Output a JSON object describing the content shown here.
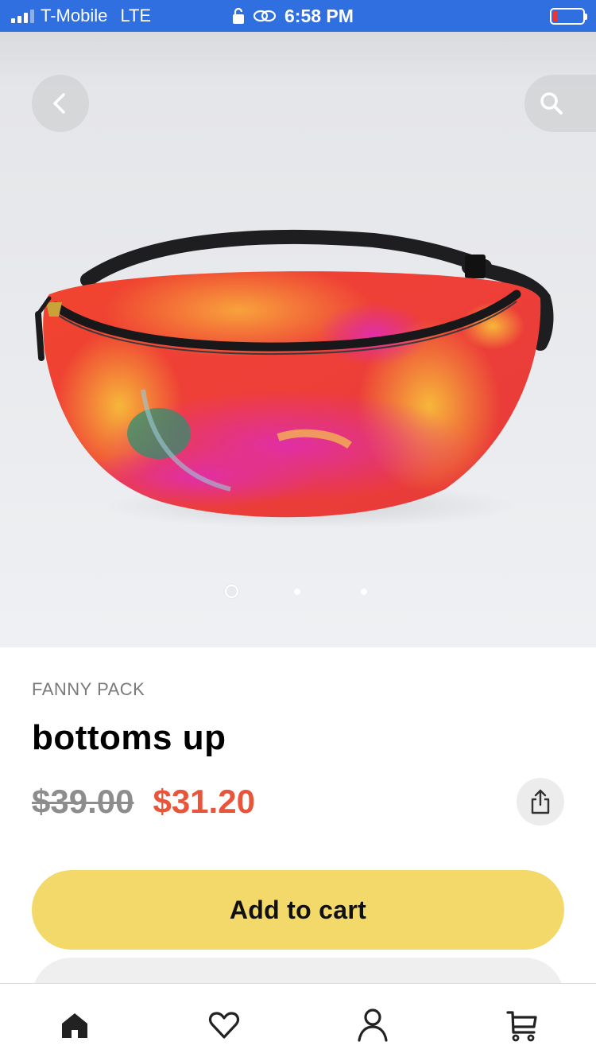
{
  "status_bar": {
    "carrier": "T-Mobile",
    "network": "LTE",
    "time": "6:58 PM",
    "battery_level": "low",
    "icons": [
      "signal-icon",
      "lock-icon",
      "link-icon",
      "battery-icon"
    ]
  },
  "hero": {
    "carousel": {
      "total_slides": 3,
      "active_index": 0
    },
    "back_icon": "chevron-left-icon",
    "search_icon": "search-icon"
  },
  "product": {
    "category": "FANNY PACK",
    "title": "bottoms up",
    "original_price": "$39.00",
    "sale_price": "$31.20",
    "share_icon": "share-icon"
  },
  "actions": {
    "add_to_cart_label": "Add to cart"
  },
  "bottom_nav": {
    "items": [
      {
        "name": "home",
        "icon": "home-icon",
        "active": true
      },
      {
        "name": "wishlist",
        "icon": "heart-icon",
        "active": false
      },
      {
        "name": "account",
        "icon": "user-icon",
        "active": false
      },
      {
        "name": "cart",
        "icon": "cart-icon",
        "active": false
      }
    ]
  },
  "colors": {
    "status_bar": "#2f6fe0",
    "sale_price": "#e8553a",
    "cart_button": "#f2d96a",
    "old_price": "#8d8d8d"
  }
}
